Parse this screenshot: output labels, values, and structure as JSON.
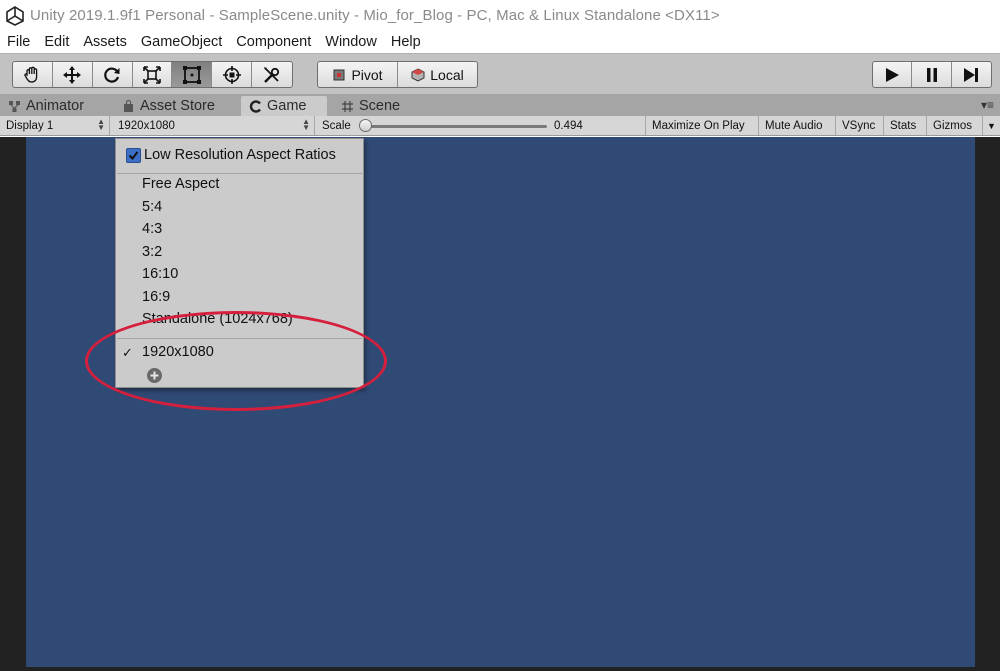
{
  "window": {
    "title": "Unity 2019.1.9f1 Personal - SampleScene.unity - Mio_for_Blog - PC, Mac & Linux Standalone <DX11>"
  },
  "menubar": {
    "items": [
      "File",
      "Edit",
      "Assets",
      "GameObject",
      "Component",
      "Window",
      "Help"
    ]
  },
  "toolbar": {
    "tools": [
      "hand-tool",
      "move-tool",
      "rotate-tool",
      "scale-tool",
      "rect-tool",
      "transform-tool",
      "custom-tool"
    ],
    "active_tool": "rect-tool",
    "pivot_label": "Pivot",
    "local_label": "Local",
    "play_controls": [
      "play",
      "pause",
      "step"
    ]
  },
  "tabs": {
    "items": [
      {
        "label": "Animator",
        "icon": "animator-icon",
        "active": false
      },
      {
        "label": "Asset Store",
        "icon": "asset-store-icon",
        "active": false
      },
      {
        "label": "Game",
        "icon": "game-icon",
        "active": true
      },
      {
        "label": "Scene",
        "icon": "scene-grid-icon",
        "active": false
      }
    ]
  },
  "gamebar": {
    "display": "Display 1",
    "resolution": "1920x1080",
    "scale_label": "Scale",
    "scale_value": "0.494",
    "scale_fraction": 0.0,
    "maximize_on_play": "Maximize On Play",
    "mute_audio": "Mute Audio",
    "vsync": "VSync",
    "stats": "Stats",
    "gizmos": "Gizmos"
  },
  "dropdown": {
    "checkbox_label": "Low Resolution Aspect Ratios",
    "checkbox_checked": true,
    "builtin_items": [
      "Free Aspect",
      "5:4",
      "4:3",
      "3:2",
      "16:10",
      "16:9",
      "Standalone (1024x768)"
    ],
    "custom_items": [
      {
        "label": "1920x1080",
        "selected": true
      }
    ],
    "selected_mark": "✓"
  },
  "colors": {
    "game_background": "#304a76",
    "annotation": "#d61f3c",
    "toolbar": "#c2c2c2"
  }
}
